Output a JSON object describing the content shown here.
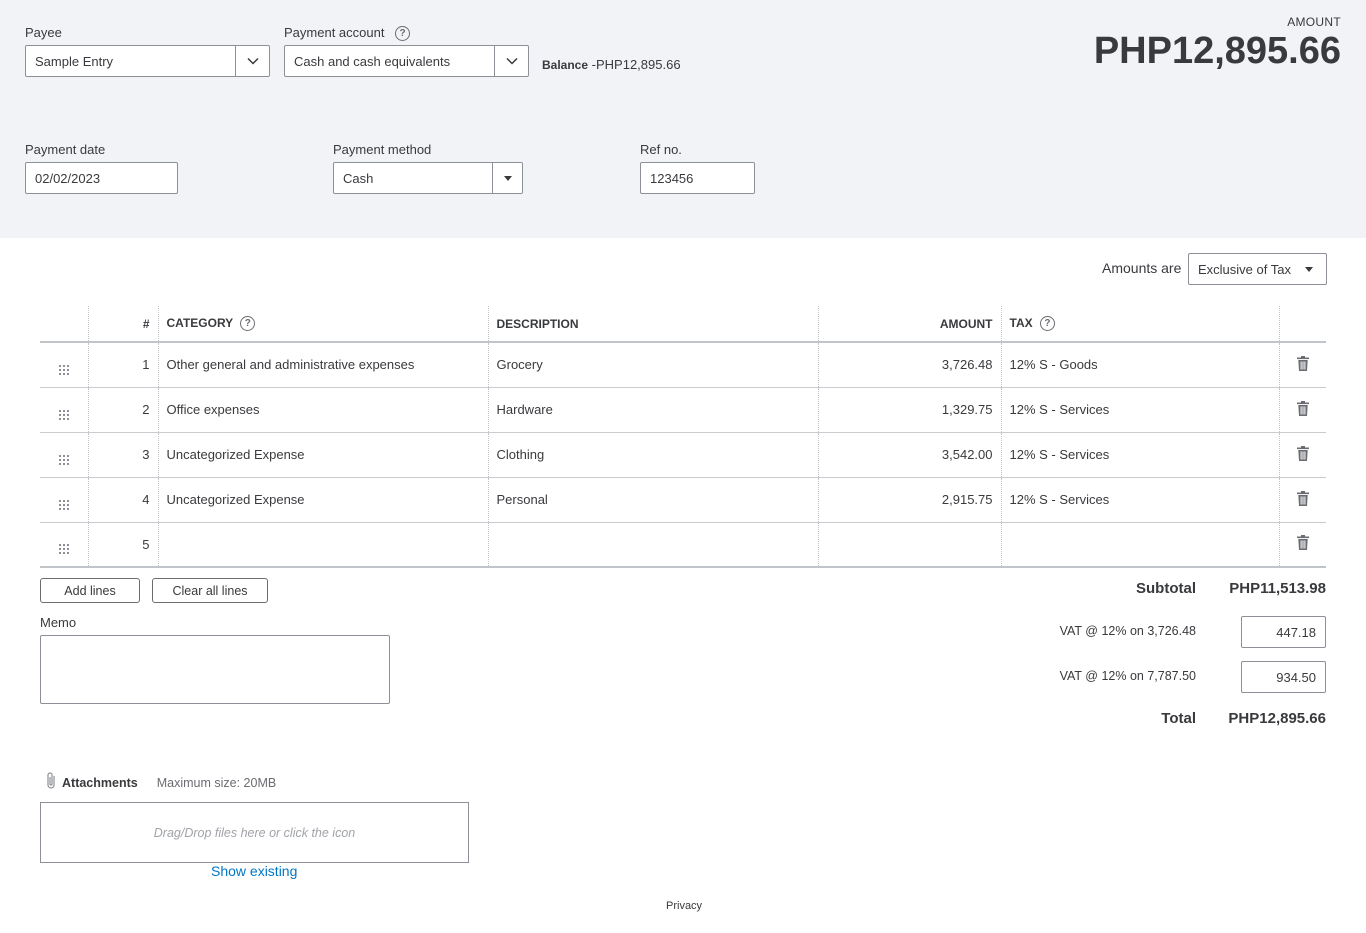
{
  "header": {
    "payee_label": "Payee",
    "payee_value": "Sample Entry",
    "payment_account_label": "Payment account",
    "payment_account_value": "Cash and cash equivalents",
    "balance_label": "Balance",
    "balance_value": "-PHP12,895.66",
    "amount_label": "AMOUNT",
    "amount_value": "PHP12,895.66",
    "payment_date_label": "Payment date",
    "payment_date_value": "02/02/2023",
    "payment_method_label": "Payment method",
    "payment_method_value": "Cash",
    "ref_label": "Ref no.",
    "ref_value": "123456"
  },
  "amounts_are": {
    "label": "Amounts are",
    "value": "Exclusive of Tax"
  },
  "table": {
    "columns": {
      "num": "#",
      "category": "CATEGORY",
      "description": "DESCRIPTION",
      "amount": "AMOUNT",
      "tax": "TAX"
    },
    "rows": [
      {
        "num": "1",
        "category": "Other general and administrative expenses",
        "description": "Grocery",
        "amount": "3,726.48",
        "tax": "12% S - Goods"
      },
      {
        "num": "2",
        "category": "Office expenses",
        "description": "Hardware",
        "amount": "1,329.75",
        "tax": "12% S - Services"
      },
      {
        "num": "3",
        "category": "Uncategorized Expense",
        "description": "Clothing",
        "amount": "3,542.00",
        "tax": "12% S - Services"
      },
      {
        "num": "4",
        "category": "Uncategorized Expense",
        "description": "Personal",
        "amount": "2,915.75",
        "tax": "12% S - Services"
      },
      {
        "num": "5",
        "category": "",
        "description": "",
        "amount": "",
        "tax": ""
      }
    ]
  },
  "buttons": {
    "add_lines": "Add lines",
    "clear_all_lines": "Clear all lines"
  },
  "totals": {
    "subtotal_label": "Subtotal",
    "subtotal_value": "PHP11,513.98",
    "vat1_label": "VAT @ 12% on 3,726.48",
    "vat1_value": "447.18",
    "vat2_label": "VAT @ 12% on 7,787.50",
    "vat2_value": "934.50",
    "total_label": "Total",
    "total_value": "PHP12,895.66"
  },
  "memo": {
    "label": "Memo",
    "value": ""
  },
  "attachments": {
    "label": "Attachments",
    "max_size": "Maximum size: 20MB",
    "drop_text": "Drag/Drop files here or click the icon",
    "show_existing": "Show existing"
  },
  "footer": {
    "privacy": "Privacy"
  },
  "icons": {
    "help": "help-circle-icon",
    "chevron": "chevron-down-icon",
    "caret": "caret-down-icon",
    "grip": "drag-handle-icon",
    "trash": "trash-icon",
    "paperclip": "paperclip-icon"
  },
  "colors": {
    "header_bg": "#f1f3f6",
    "text": "#393a3d",
    "link": "#0077c5",
    "border": "#8d9096"
  }
}
